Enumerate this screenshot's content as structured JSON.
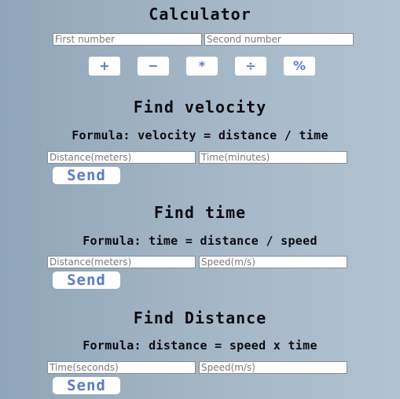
{
  "calculator": {
    "title": "Calculator",
    "first_placeholder": "First number",
    "second_placeholder": "Second number",
    "ops": [
      {
        "label": "+"
      },
      {
        "label": "−"
      },
      {
        "label": "*"
      },
      {
        "label": "÷"
      },
      {
        "label": "%"
      }
    ]
  },
  "velocity": {
    "title": "Find velocity",
    "formula": "Formula: velocity = distance / time",
    "input1_placeholder": "Distance(meters)",
    "input2_placeholder": "Time(minutes)",
    "send_label": "Send"
  },
  "time": {
    "title": "Find time",
    "formula": "Formula: time = distance / speed",
    "input1_placeholder": "Distance(meters)",
    "input2_placeholder": "Speed(m/s)",
    "send_label": "Send"
  },
  "distance": {
    "title": "Find Distance",
    "formula": "Formula: distance = speed x time",
    "input1_placeholder": "Time(seconds)",
    "input2_placeholder": "Speed(m/s)",
    "send_label": "Send"
  }
}
